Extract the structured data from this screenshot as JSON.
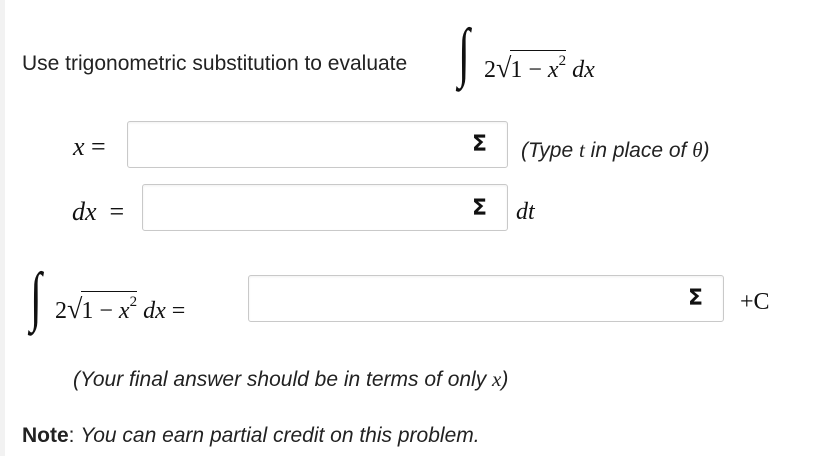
{
  "problem": {
    "prompt": "Use trigonometric substitution to evaluate",
    "integrand": {
      "coefficient": "2",
      "radicand_one": "1",
      "minus": "−",
      "var": "x",
      "power": "2",
      "differential": "dx"
    }
  },
  "rows": {
    "x": {
      "lhs_var": "x",
      "equals": "=",
      "input_value": "",
      "hint_prefix": "(Type ",
      "hint_t": "t",
      "hint_middle": " in place of ",
      "hint_theta": "θ",
      "hint_suffix": ")"
    },
    "dx": {
      "lhs": "dx",
      "equals": "=",
      "input_value": "",
      "suffix": "dt"
    },
    "integral": {
      "coefficient": "2",
      "radicand_one": "1",
      "minus": "−",
      "var": "x",
      "power": "2",
      "differential": "dx",
      "equals": "=",
      "input_value": "",
      "suffix": "+C"
    }
  },
  "equation_editor_icon": "Σ",
  "final_hint": {
    "prefix": "(Your final answer should be in terms of only ",
    "var": "x",
    "suffix": ")"
  },
  "note": {
    "label": "Note",
    "separator": ": ",
    "text": "You can earn partial credit on this problem."
  }
}
